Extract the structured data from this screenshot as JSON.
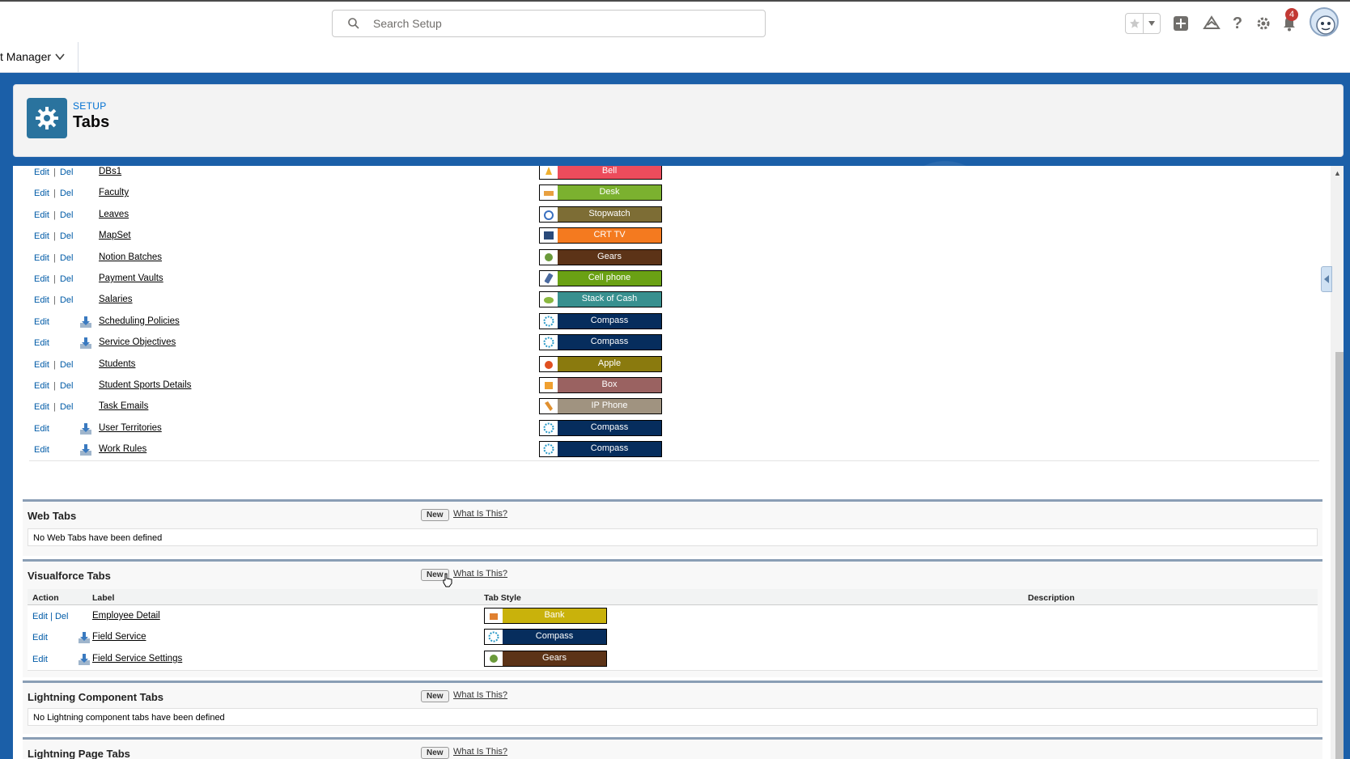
{
  "header": {
    "search_placeholder": "Search Setup",
    "notification_count": "4"
  },
  "app_nav": {
    "app_name": "t Manager"
  },
  "setup": {
    "breadcrumb": "SETUP",
    "title": "Tabs"
  },
  "custom_object_tabs": [
    {
      "actions": "edit-del",
      "label": "DBs1",
      "style": "Bell",
      "color": "#ec4c5c",
      "installed": false
    },
    {
      "actions": "edit-del",
      "label": "Faculty",
      "style": "Desk",
      "color": "#7bb12f",
      "installed": false
    },
    {
      "actions": "edit-del",
      "label": "Leaves",
      "style": "Stopwatch",
      "color": "#7d6d35",
      "installed": false
    },
    {
      "actions": "edit-del",
      "label": "MapSet",
      "style": "CRT TV",
      "color": "#f47a1f",
      "installed": false
    },
    {
      "actions": "edit-del",
      "label": "Notion Batches",
      "style": "Gears",
      "color": "#5c3317",
      "installed": false
    },
    {
      "actions": "edit-del",
      "label": "Payment Vaults",
      "style": "Cell phone",
      "color": "#6aa114",
      "installed": false
    },
    {
      "actions": "edit-del",
      "label": "Salaries",
      "style": "Stack of Cash",
      "color": "#38908f",
      "installed": false
    },
    {
      "actions": "edit",
      "label": "Scheduling Policies",
      "style": "Compass",
      "color": "#062d5d",
      "installed": true
    },
    {
      "actions": "edit",
      "label": "Service Objectives",
      "style": "Compass",
      "color": "#062d5d",
      "installed": true
    },
    {
      "actions": "edit-del",
      "label": "Students",
      "style": "Apple",
      "color": "#8a7a0e",
      "installed": false
    },
    {
      "actions": "edit-del",
      "label": "Student Sports Details",
      "style": "Box",
      "color": "#9a6261",
      "installed": false
    },
    {
      "actions": "edit-del",
      "label": "Task Emails",
      "style": "IP Phone",
      "color": "#a09380",
      "installed": false
    },
    {
      "actions": "edit",
      "label": "User Territories",
      "style": "Compass",
      "color": "#062d5d",
      "installed": true
    },
    {
      "actions": "edit",
      "label": "Work Rules",
      "style": "Compass",
      "color": "#062d5d",
      "installed": true
    }
  ],
  "labels": {
    "edit": "Edit",
    "del": "Del",
    "sep": "|",
    "new": "New",
    "what": "What Is This?"
  },
  "web_tabs": {
    "title": "Web Tabs",
    "empty": "No Web Tabs have been defined"
  },
  "visualforce_tabs": {
    "title": "Visualforce Tabs",
    "columns": {
      "action": "Action",
      "label": "Label",
      "style": "Tab Style",
      "description": "Description"
    },
    "rows": [
      {
        "actions": "edit-del",
        "label": "Employee Detail",
        "style": "Bank",
        "color": "#c9b20b",
        "installed": false
      },
      {
        "actions": "edit",
        "label": "Field Service",
        "style": "Compass",
        "color": "#062d5d",
        "installed": true
      },
      {
        "actions": "edit",
        "label": "Field Service Settings",
        "style": "Gears",
        "color": "#5c3317",
        "installed": true
      }
    ]
  },
  "lightning_component_tabs": {
    "title": "Lightning Component Tabs",
    "empty": "No Lightning component tabs have been defined"
  },
  "lightning_page_tabs": {
    "title": "Lightning Page Tabs"
  }
}
